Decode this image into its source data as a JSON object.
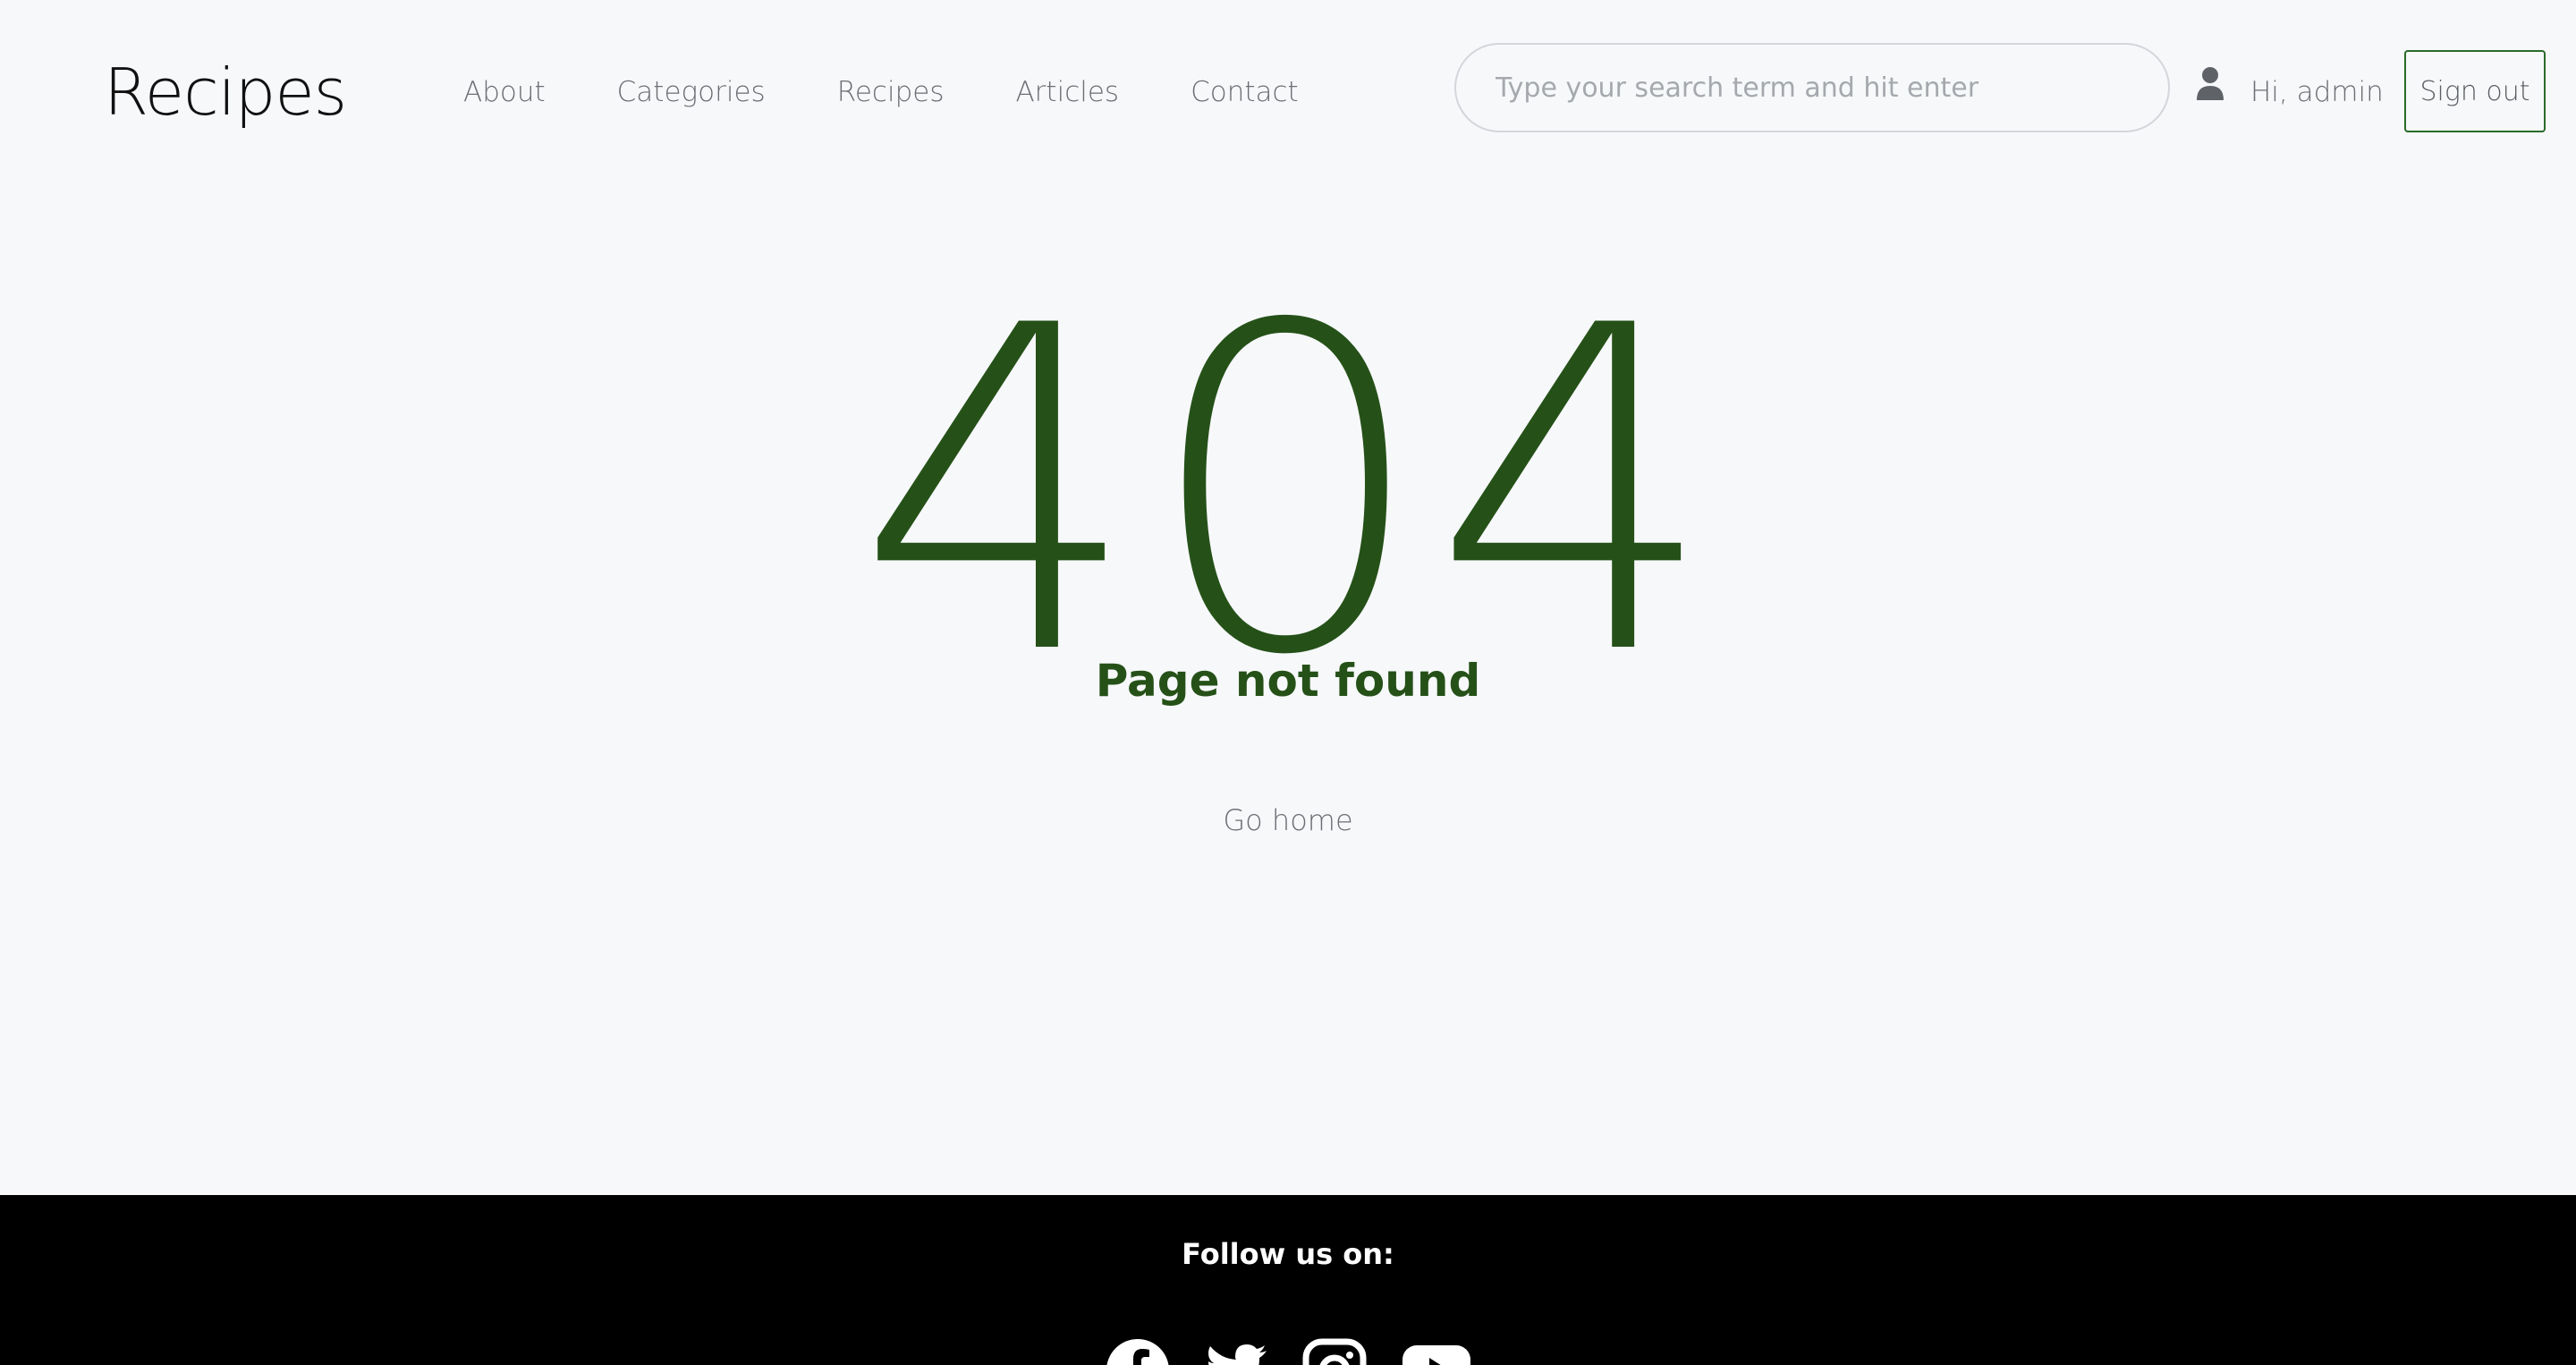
{
  "header": {
    "logo": "Recipes",
    "nav": [
      "About",
      "Categories",
      "Recipes",
      "Articles",
      "Contact"
    ],
    "search_placeholder": "Type your search term and hit enter",
    "greeting": "Hi, admin",
    "signout_label": "Sign out"
  },
  "main": {
    "code": "404",
    "message": "Page not found",
    "home_link": "Go home"
  },
  "footer": {
    "follow_label": "Follow us on:",
    "socials": [
      "facebook-icon",
      "twitter-icon",
      "instagram-icon",
      "youtube-icon"
    ]
  },
  "colors": {
    "accent": "#255118",
    "background": "#f7f8fa",
    "footer": "#000000"
  }
}
